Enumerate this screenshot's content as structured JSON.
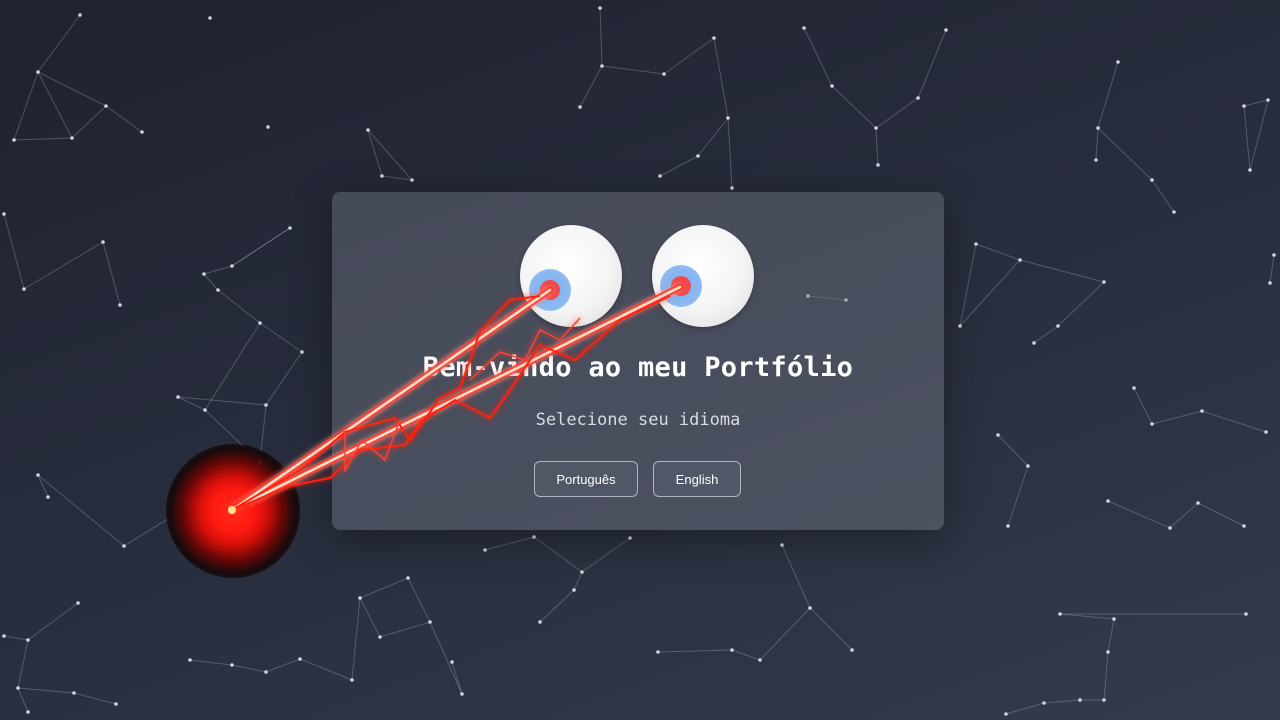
{
  "welcome": {
    "title": "Bem-vindo ao meu Portfólio",
    "subtitle": "Selecione seu idioma"
  },
  "language_buttons": {
    "portuguese_label": "Português",
    "english_label": "English"
  },
  "colors": {
    "background": "#272c3c",
    "card": "#6f7383",
    "pupil": "#ef4b4b",
    "iris": "#8ab8f2",
    "laser": "#ff2a1a"
  }
}
